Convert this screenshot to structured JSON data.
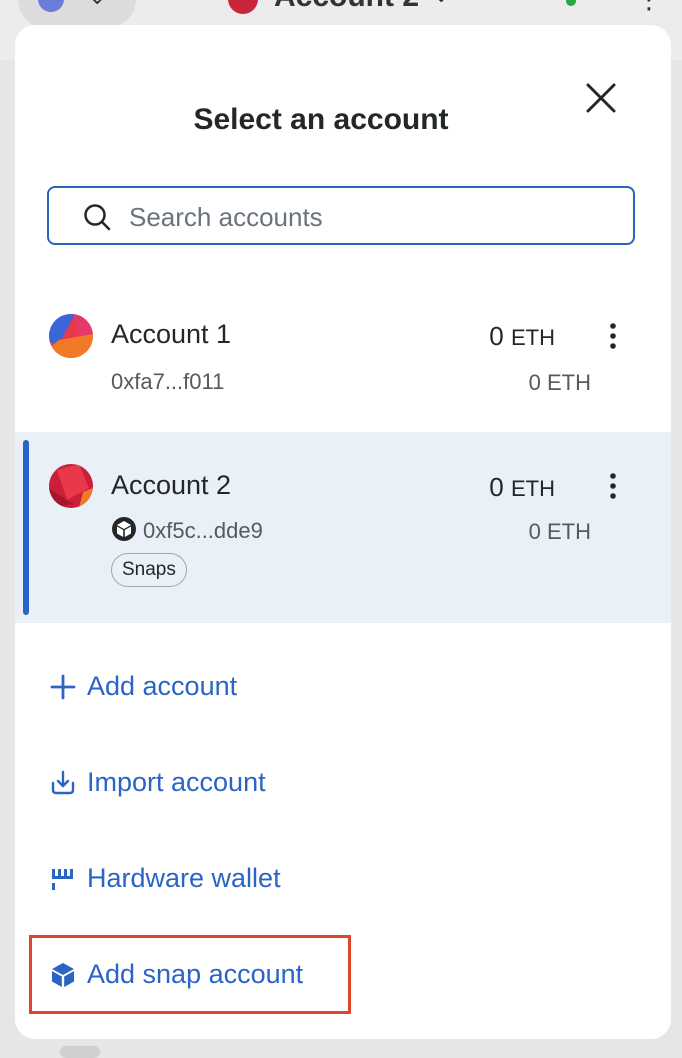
{
  "background": {
    "header_account_name": "Account 2"
  },
  "modal": {
    "title": "Select an account",
    "close_icon": "close-icon"
  },
  "search": {
    "placeholder": "Search accounts",
    "value": ""
  },
  "accounts": [
    {
      "name": "Account 1",
      "address": "0xfa7...f011",
      "balance": "0",
      "balance_unit": "ETH",
      "fiat": "0 ETH",
      "selected": false
    },
    {
      "name": "Account 2",
      "address": "0xf5c...dde9",
      "balance": "0",
      "balance_unit": "ETH",
      "fiat": "0 ETH",
      "tag": "Snaps",
      "selected": true
    }
  ],
  "actions": {
    "add_account": "Add account",
    "import_account": "Import account",
    "hardware_wallet": "Hardware wallet",
    "add_snap_account": "Add snap account"
  },
  "colors": {
    "accent": "#2a64c4",
    "selected_bg": "#eaf0f8",
    "highlight": "#e0452b"
  }
}
